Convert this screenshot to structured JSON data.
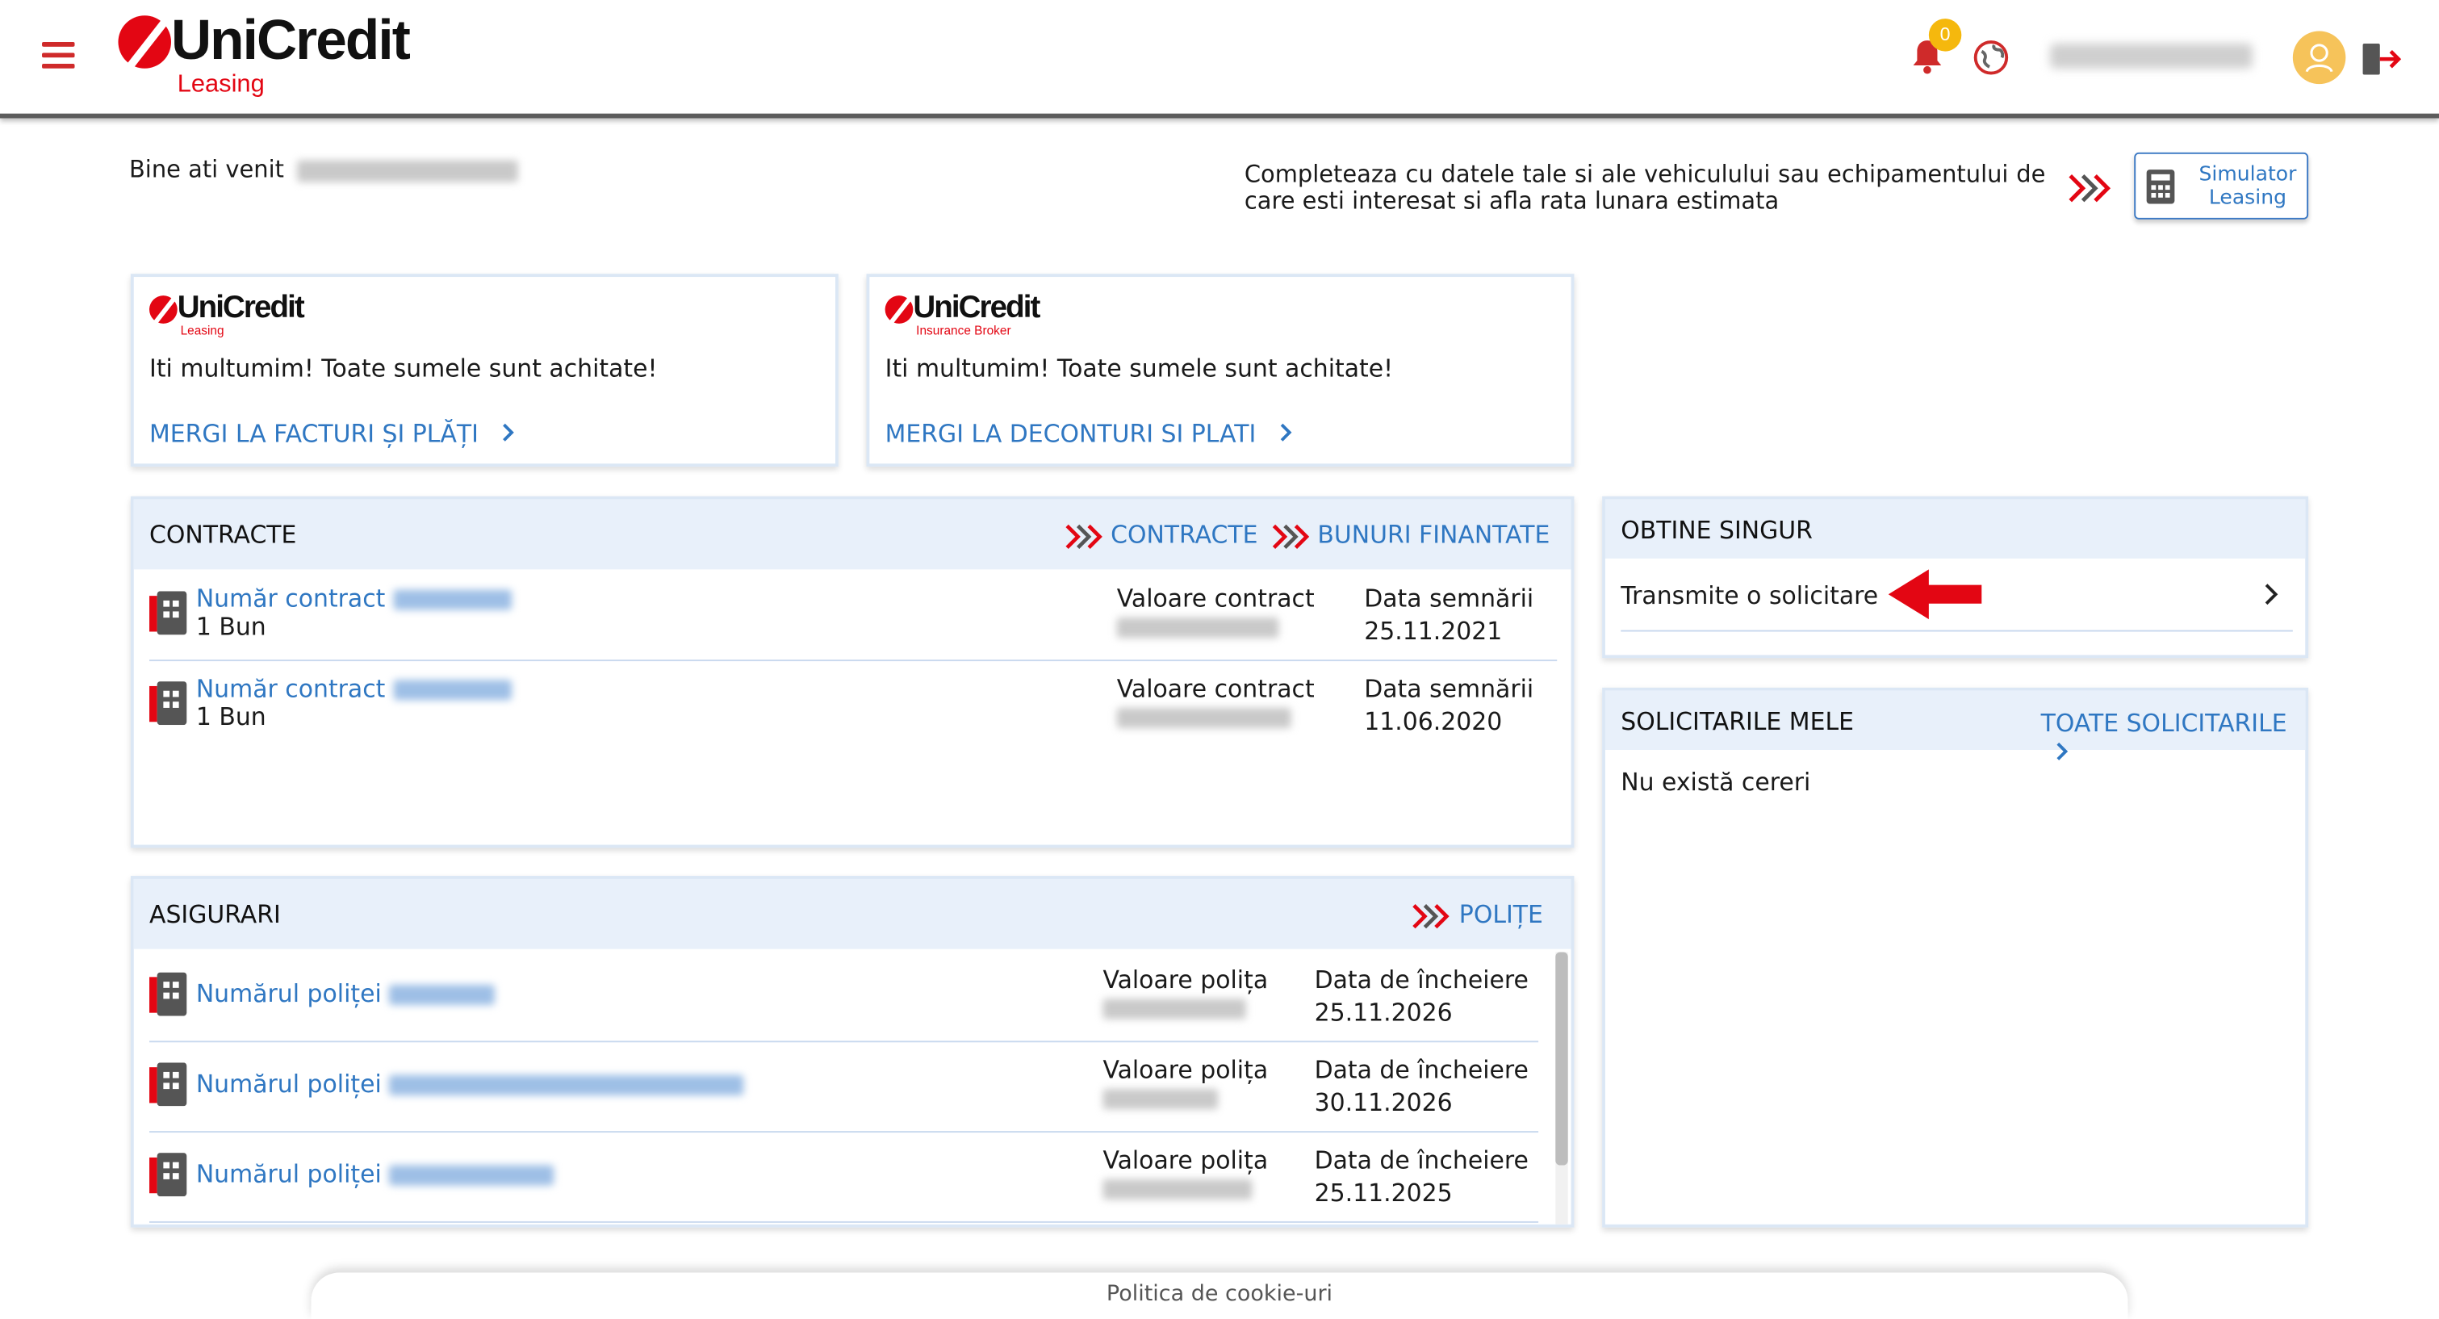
{
  "header": {
    "brand": "UniCredit",
    "brand_sub": "Leasing",
    "notifications_count": "0"
  },
  "welcome": {
    "text": "Bine ati venit"
  },
  "promo": {
    "text": "Completeaza cu datele tale si ale vehiculului sau echipamentului de care esti interesat si afla rata lunara estimata",
    "button_line1": "Simulator",
    "button_line2": "Leasing"
  },
  "cards": [
    {
      "brand": "UniCredit",
      "brand_sub": "Leasing",
      "message": "Iti multumim! Toate sumele sunt achitate!",
      "link": "MERGI LA FACTURI ȘI PLĂȚI"
    },
    {
      "brand": "UniCredit",
      "brand_sub": "Insurance Broker",
      "message": "Iti multumim! Toate sumele sunt achitate!",
      "link": "MERGI LA DECONTURI SI PLATI"
    }
  ],
  "contracts": {
    "title": "CONTRACTE",
    "link1": "CONTRACTE",
    "link2": "BUNURI FINANTATE",
    "rows": [
      {
        "label": "Număr contract",
        "sub": "1 Bun",
        "value_label": "Valoare contract",
        "date_label": "Data semnării",
        "date": "25.11.2021"
      },
      {
        "label": "Număr contract",
        "sub": "1 Bun",
        "value_label": "Valoare contract",
        "date_label": "Data semnării",
        "date": "11.06.2020"
      }
    ]
  },
  "insurance": {
    "title": "ASIGURARI",
    "link": "POLIȚE",
    "rows": [
      {
        "label": "Numărul poliței",
        "value_label": "Valoare polița",
        "date_label": "Data de încheiere",
        "date": "25.11.2026"
      },
      {
        "label": "Numărul poliței",
        "value_label": "Valoare polița",
        "date_label": "Data de încheiere",
        "date": "30.11.2026"
      },
      {
        "label": "Numărul poliței",
        "value_label": "Valoare polița",
        "date_label": "Data de încheiere",
        "date": "25.11.2025"
      }
    ]
  },
  "self_service": {
    "title": "OBTINE SINGUR",
    "item": "Transmite o solicitare"
  },
  "requests": {
    "title": "SOLICITARILE MELE",
    "link": "TOATE SOLICITARILE",
    "empty": "Nu există cereri"
  },
  "footer": {
    "cookie": "Politica de cookie-uri"
  },
  "colors": {
    "brand_red": "#e30613",
    "link_blue": "#2f77c2",
    "panel_header": "#e8f0fa",
    "badge": "#f5b80d"
  },
  "icons": [
    "menu-icon",
    "bell-icon",
    "globe-icon",
    "avatar-icon",
    "logout-icon",
    "triple-chevron-icon",
    "calculator-icon",
    "chevron-right-icon",
    "document-icon",
    "red-arrow-icon"
  ]
}
